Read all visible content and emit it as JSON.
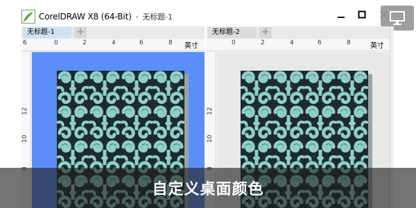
{
  "window": {
    "title": "CorelDRAW X8 (64-Bit)",
    "separator": "-",
    "document_title": "无标题-1",
    "controls": {
      "minimize_icon": "minimize-icon",
      "maximize_icon": "maximize-icon",
      "close_icon": "close-icon"
    },
    "overlay_icon": "monitor-icon"
  },
  "left_view": {
    "tab_label": "无标题-1",
    "add_tab": "+",
    "ruler_top": [
      "6",
      "0",
      "2",
      "4",
      "6",
      "8"
    ],
    "ruler_unit": "英寸",
    "ruler_left": [
      "12",
      "10",
      "8"
    ],
    "canvas_color": "#5b8ff7"
  },
  "right_view": {
    "tab_label": "无标题-2",
    "add_tab": "+",
    "ruler_top": [
      "0",
      "2",
      "4",
      "6",
      "8"
    ],
    "ruler_unit": "英寸",
    "ruler_left": [
      "12",
      "10",
      "8"
    ],
    "canvas_color": "#e8e8e8"
  },
  "pattern_colors": {
    "background": "#1d2a2e",
    "foreground": "#8fcfc8"
  },
  "caption": "自定义桌面颜色"
}
